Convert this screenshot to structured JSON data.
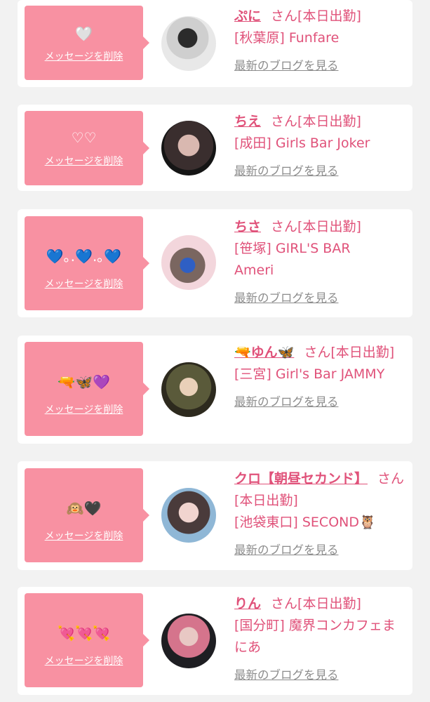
{
  "common": {
    "delete_label": "メッセージを削除",
    "blog_label": "最新のブログを見る",
    "san": "さん",
    "status": "[本日出勤]"
  },
  "colors": {
    "bubble": "#f891a2",
    "accent": "#e0527a",
    "link_gray": "#8c8c8c"
  },
  "entries": [
    {
      "message": "🤍",
      "name": "ぷに",
      "shop": "[秋葉原] Funfare"
    },
    {
      "message": "♡♡",
      "name": "ちえ",
      "shop": "[成田] Girls Bar Joker"
    },
    {
      "message": "💙｡.💙.｡💙",
      "name": "ちさ",
      "shop": "[笹塚] GIRL'S BAR Ameri"
    },
    {
      "message": "🔫🦋💜",
      "name": "🔫ゆん🦋",
      "shop": "[三宮] Girl's Bar JAMMY"
    },
    {
      "message": "🙉🖤",
      "name": "クロ【朝昼セカンド】",
      "shop": "[池袋東口] SECOND🦉"
    },
    {
      "message": "💘💘💘",
      "name": "りん",
      "shop": "[国分町] 魔界コンカフェまにあ"
    }
  ]
}
